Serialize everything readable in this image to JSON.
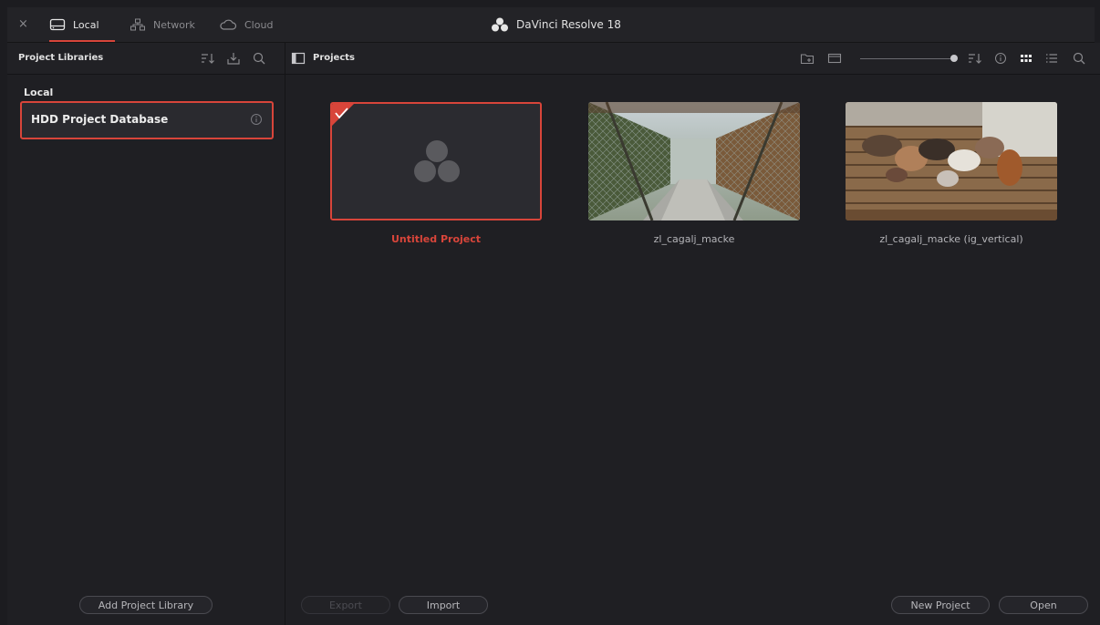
{
  "topbar": {
    "close_glyph": "×",
    "tabs": [
      {
        "label": "Local",
        "icon": "hard-drive-icon",
        "active": true
      },
      {
        "label": "Network",
        "icon": "network-icon",
        "active": false
      },
      {
        "label": "Cloud",
        "icon": "cloud-icon",
        "active": false
      }
    ],
    "app_title": "DaVinci Resolve 18"
  },
  "left_panel": {
    "title": "Project Libraries",
    "section_label": "Local",
    "database_item": "HDD Project Database",
    "add_library_button": "Add Project Library"
  },
  "right_panel": {
    "title": "Projects",
    "projects": [
      {
        "name": "Untitled Project",
        "selected": true,
        "thumbnail": "davinci-logo-placeholder"
      },
      {
        "name": "zl_cagalj_macke",
        "selected": false,
        "thumbnail": "photo-cage-walkway"
      },
      {
        "name": "zl_cagalj_macke (ig_vertical)",
        "selected": false,
        "thumbnail": "photo-cats-on-planks"
      }
    ],
    "buttons": {
      "export": "Export",
      "import": "Import",
      "new_project": "New Project",
      "open": "Open"
    }
  },
  "colors": {
    "accent": "#d8453a",
    "background": "#1c1c20",
    "panel": "#1f1f23"
  }
}
